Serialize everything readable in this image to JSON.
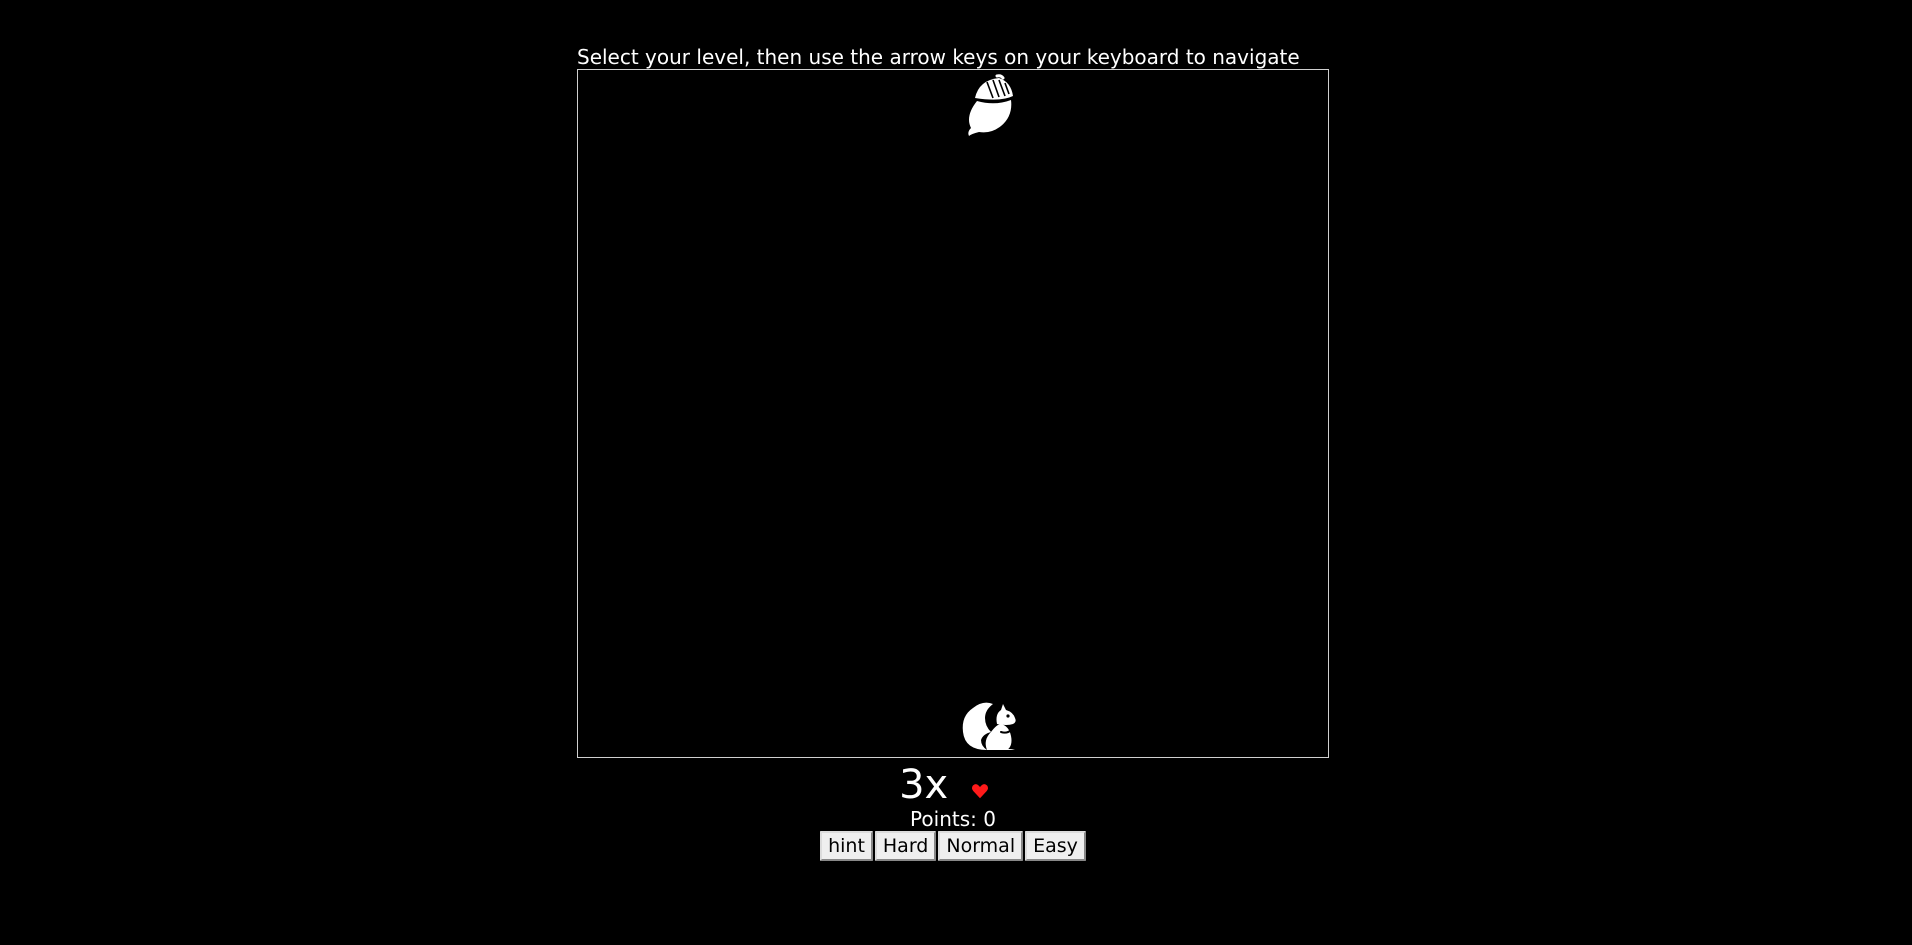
{
  "header": {
    "instructions": "Select your level, then use the arrow keys on your keyboard to navigate"
  },
  "board": {
    "target_icon": "acorn-icon",
    "player_icon": "squirrel-icon",
    "border_color": "#d0d0d0",
    "background": "#000000"
  },
  "status": {
    "lives": "3x",
    "lives_icon": "heart-icon",
    "heart_color": "#ff1a1a",
    "points": "Points: 0"
  },
  "controls": {
    "hint_label": "hint",
    "hard_label": "Hard",
    "normal_label": "Normal",
    "easy_label": "Easy"
  }
}
